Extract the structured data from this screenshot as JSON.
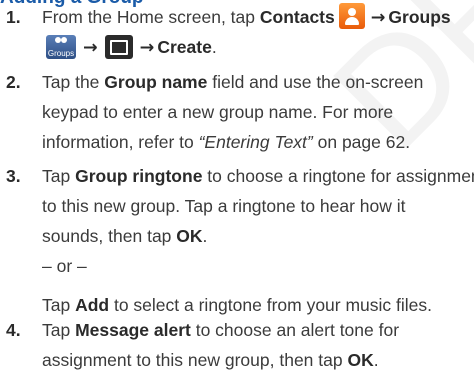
{
  "heading": {
    "text": "Adding a Group"
  },
  "watermark": "DRAFT",
  "steps": [
    {
      "num": "1.",
      "p1": "From the Home screen, tap ",
      "contacts": "Contacts",
      "groups": "Groups",
      "groups_icon_caption": "Groups",
      "arrow": "→",
      "create": "Create",
      "period": "."
    },
    {
      "num": "2.",
      "p1": "Tap the ",
      "b1": "Group name",
      "p2": " field and use the on-screen",
      "l2": "keypad to enter a new group name. For more",
      "l3a": "information, refer to ",
      "l3i": "“Entering Text”",
      "l3b": "  on page 62."
    },
    {
      "num": "3.",
      "p1": "Tap ",
      "b1": "Group ringtone",
      "p2": " to choose a ringtone for assignment",
      "l2": "to this new group. Tap a ringtone to hear how it",
      "l3a": "sounds, then tap ",
      "l3b": "OK",
      "l3c": ".",
      "or": "– or –",
      "l5a": "Tap ",
      "l5b": "Add",
      "l5c": " to select a ringtone from your music files."
    },
    {
      "num": "4.",
      "p1": "Tap ",
      "b1": "Message alert",
      "p2": " to choose an alert tone for",
      "l2a": "assignment to this new group, then tap ",
      "l2b": "OK",
      "l2c": "."
    }
  ],
  "colors": {
    "heading": "#1a5ba8",
    "text": "#3b3b3b",
    "contacts_icon": "#f07a1e",
    "groups_icon": "#3e629c",
    "menu_icon": "#2b2b2b"
  }
}
